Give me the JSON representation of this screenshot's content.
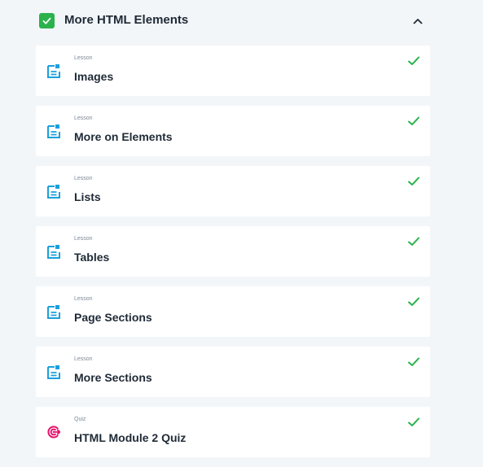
{
  "module": {
    "title": "More HTML Elements",
    "completed_icon": "checkbox-checked-icon",
    "toggle_icon": "chevron-up-icon",
    "accent_color": "#2bb24c"
  },
  "items": [
    {
      "type": "Lesson",
      "title": "Images",
      "icon": "lesson-document-icon",
      "status": "completed"
    },
    {
      "type": "Lesson",
      "title": "More on Elements",
      "icon": "lesson-document-icon",
      "status": "completed"
    },
    {
      "type": "Lesson",
      "title": "Lists",
      "icon": "lesson-document-icon",
      "status": "completed"
    },
    {
      "type": "Lesson",
      "title": "Tables",
      "icon": "lesson-document-icon",
      "status": "completed"
    },
    {
      "type": "Lesson",
      "title": "Page Sections",
      "icon": "lesson-document-icon",
      "status": "completed"
    },
    {
      "type": "Lesson",
      "title": "More Sections",
      "icon": "lesson-document-icon",
      "status": "completed"
    },
    {
      "type": "Quiz",
      "title": "HTML Module 2 Quiz",
      "icon": "quiz-target-icon",
      "status": "completed"
    }
  ],
  "colors": {
    "lesson_icon": "#1aa0dc",
    "quiz_icon": "#e8116a",
    "check": "#2bb24c"
  }
}
